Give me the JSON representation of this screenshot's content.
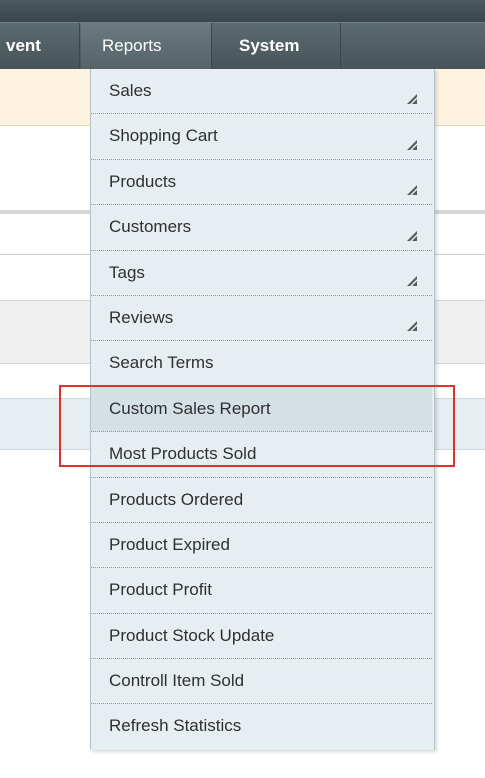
{
  "nav": {
    "event_label": "vent",
    "reports_label": "Reports",
    "system_label": "System"
  },
  "reports_menu": {
    "items": [
      {
        "label": "Sales",
        "has_submenu": true
      },
      {
        "label": "Shopping Cart",
        "has_submenu": true
      },
      {
        "label": "Products",
        "has_submenu": true
      },
      {
        "label": "Customers",
        "has_submenu": true
      },
      {
        "label": "Tags",
        "has_submenu": true
      },
      {
        "label": "Reviews",
        "has_submenu": true
      },
      {
        "label": "Search Terms",
        "has_submenu": false
      },
      {
        "label": "Custom Sales Report",
        "has_submenu": false,
        "highlighted": true
      },
      {
        "label": "Most Products Sold",
        "has_submenu": false
      },
      {
        "label": "Products Ordered",
        "has_submenu": false
      },
      {
        "label": "Product Expired",
        "has_submenu": false
      },
      {
        "label": "Product Profit",
        "has_submenu": false
      },
      {
        "label": "Product Stock Update",
        "has_submenu": false
      },
      {
        "label": "Controll Item Sold",
        "has_submenu": false
      },
      {
        "label": "Refresh Statistics",
        "has_submenu": false
      }
    ]
  },
  "annotation": {
    "highlight_color": "#e0312f",
    "target_item": "Custom Sales Report"
  },
  "colors": {
    "nav_bg": "#4f5e64",
    "menu_bg": "#e7eef1",
    "menu_hover_bg": "#d4e0e4",
    "menu_text": "#2f2f2f"
  }
}
